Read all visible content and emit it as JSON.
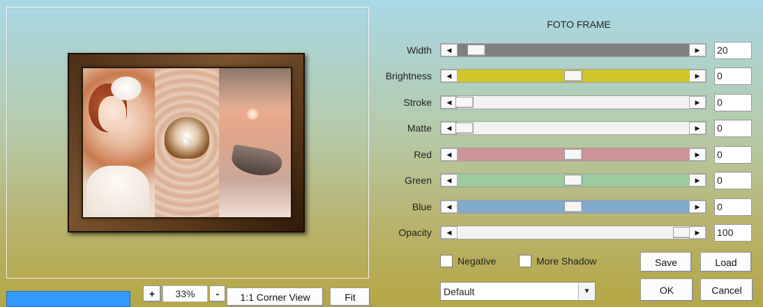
{
  "panel": {
    "title": "FOTO FRAME"
  },
  "sliders": [
    {
      "key": "width",
      "label": "Width",
      "value": "20",
      "fraction": 0.08,
      "track_color": "#808080"
    },
    {
      "key": "brightness",
      "label": "Brightness",
      "value": "0",
      "fraction": 0.5,
      "track_color": "#cfc62b"
    },
    {
      "key": "stroke",
      "label": "Stroke",
      "value": "0",
      "fraction": 0.03,
      "track_color": "#f3f3f3"
    },
    {
      "key": "matte",
      "label": "Matte",
      "value": "0",
      "fraction": 0.03,
      "track_color": "#f3f3f3"
    },
    {
      "key": "red",
      "label": "Red",
      "value": "0",
      "fraction": 0.5,
      "track_color": "#cc9496"
    },
    {
      "key": "green",
      "label": "Green",
      "value": "0",
      "fraction": 0.5,
      "track_color": "#9bcb9e"
    },
    {
      "key": "blue",
      "label": "Blue",
      "value": "0",
      "fraction": 0.5,
      "track_color": "#82aacc"
    },
    {
      "key": "opacity",
      "label": "Opacity",
      "value": "100",
      "fraction": 0.97,
      "track_color": "#f3f3f3"
    }
  ],
  "options": {
    "negative_label": "Negative",
    "more_shadow_label": "More Shadow"
  },
  "preset": {
    "selected": "Default"
  },
  "buttons": {
    "save": "Save",
    "load": "Load",
    "ok": "OK",
    "cancel": "Cancel"
  },
  "zoom": {
    "plus": "+",
    "minus": "-",
    "level": "33%",
    "corner_view": "1:1 Corner View",
    "fit": "Fit"
  },
  "colors": {
    "progress_bar": "#3399ff"
  }
}
